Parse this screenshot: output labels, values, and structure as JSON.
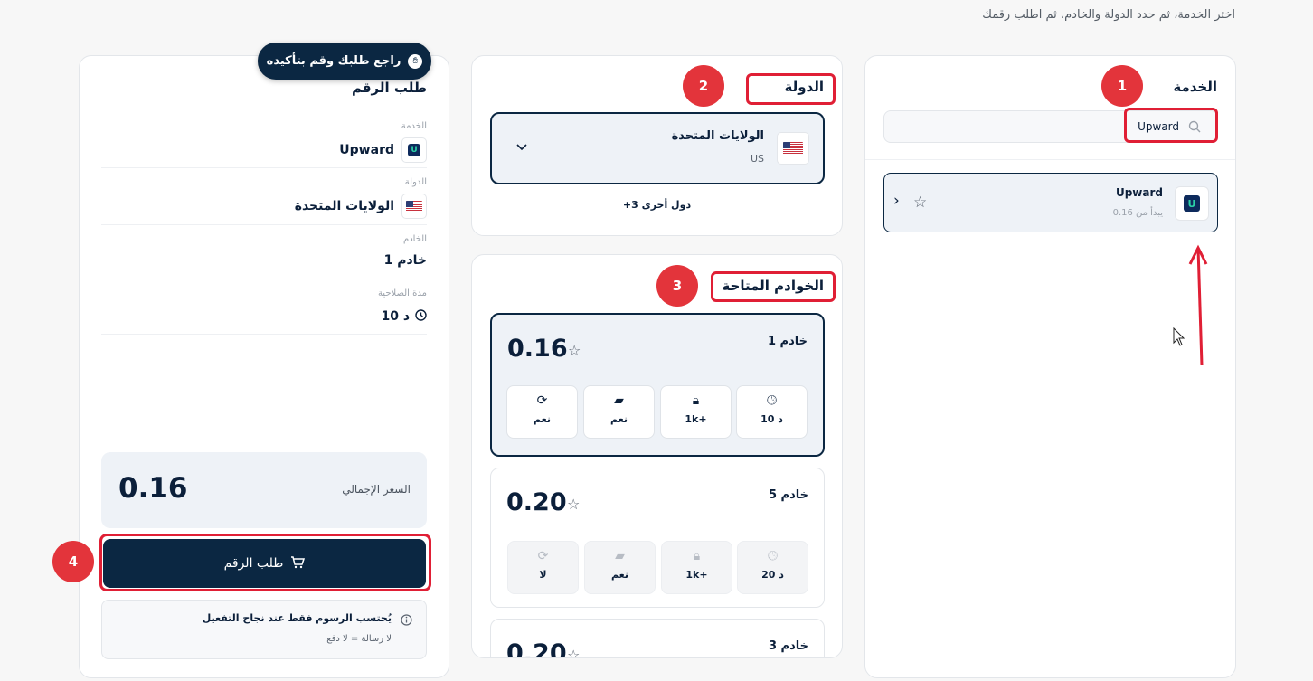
{
  "instruction": "اختر الخدمة، ثم حدد الدولة والخادم، ثم اطلب رقمك",
  "service_panel": {
    "title": "الخدمة",
    "search": {
      "value": "Upward",
      "placeholder": ""
    },
    "items": [
      {
        "name": "Upward",
        "subtitle": "يبدأ من 0.16",
        "logo": "U"
      }
    ]
  },
  "country_panel": {
    "title": "الدولة",
    "selected": {
      "name": "الولايات المتحدة",
      "code": "US"
    },
    "more": "+3 دول أخرى"
  },
  "servers_panel": {
    "title": "الخوادم المتاحة",
    "servers": [
      {
        "name": "خادم 1",
        "price": "0.16",
        "duration": "10 د",
        "capacity": "1k+",
        "sms": "نعم",
        "renew": "نعم"
      },
      {
        "name": "خادم 5",
        "price": "0.20",
        "duration": "20 د",
        "capacity": "1k+",
        "sms": "نعم",
        "renew": "لا"
      },
      {
        "name": "خادم 3",
        "price": "0.20"
      }
    ]
  },
  "order_panel": {
    "tooltip": "راجع طلبك وقم بتأكيده",
    "title": "طلب الرقم",
    "service_label": "الخدمة",
    "service_value": "Upward",
    "country_label": "الدولة",
    "country_value": "الولايات المتحدة",
    "server_label": "الخادم",
    "server_value": "خادم 1",
    "validity_label": "مدة الصلاحية",
    "validity_value": "10 د",
    "total_label": "السعر الإجمالي",
    "total_value": "0.16",
    "order_button": "طلب الرقم",
    "notice_title": "يُحتسب الرسوم فقط عند نجاح التفعيل",
    "notice_sub": "لا رسالة = لا دفع"
  },
  "badges": [
    "1",
    "2",
    "3",
    "4"
  ],
  "colors": {
    "navy": "#0b2742",
    "accent_red": "#e01f35",
    "badge_red": "#e3343b"
  }
}
